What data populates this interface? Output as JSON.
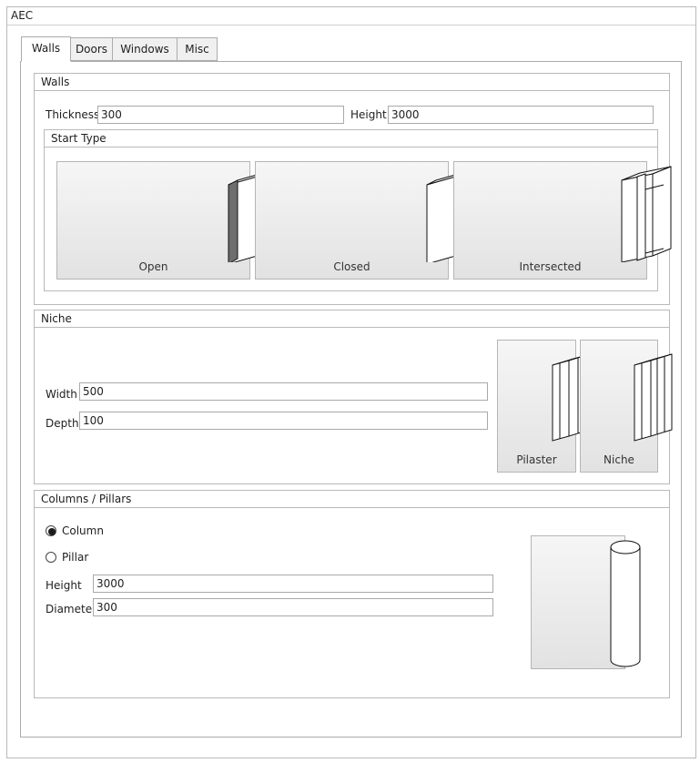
{
  "window": {
    "title": "AEC"
  },
  "tabs": [
    {
      "label": "Walls",
      "active": true
    },
    {
      "label": "Doors",
      "active": false
    },
    {
      "label": "Windows",
      "active": false
    },
    {
      "label": "Misc",
      "active": false
    }
  ],
  "walls": {
    "group_title": "Walls",
    "thickness_label": "Thickness",
    "thickness_value": "300",
    "height_label": "Height",
    "height_value": "3000",
    "start_type": {
      "title": "Start Type",
      "options": [
        {
          "label": "Open",
          "icon": "open-wall-icon"
        },
        {
          "label": "Closed",
          "icon": "closed-wall-icon"
        },
        {
          "label": "Intersected",
          "icon": "intersected-wall-icon"
        }
      ]
    }
  },
  "niche": {
    "group_title": "Niche",
    "width_label": "Width",
    "width_value": "500",
    "depth_label": "Depth",
    "depth_value": "100",
    "options": [
      {
        "label": "Pilaster",
        "icon": "pilaster-icon"
      },
      {
        "label": "Niche",
        "icon": "niche-icon"
      }
    ]
  },
  "columns": {
    "group_title": "Columns / Pillars",
    "radio_column": "Column",
    "radio_pillar": "Pillar",
    "selected": "Column",
    "height_label": "Height",
    "height_value": "3000",
    "diameter_label": "Diameter",
    "diameter_value": "300",
    "preview_icon": "column-cylinder-icon"
  }
}
